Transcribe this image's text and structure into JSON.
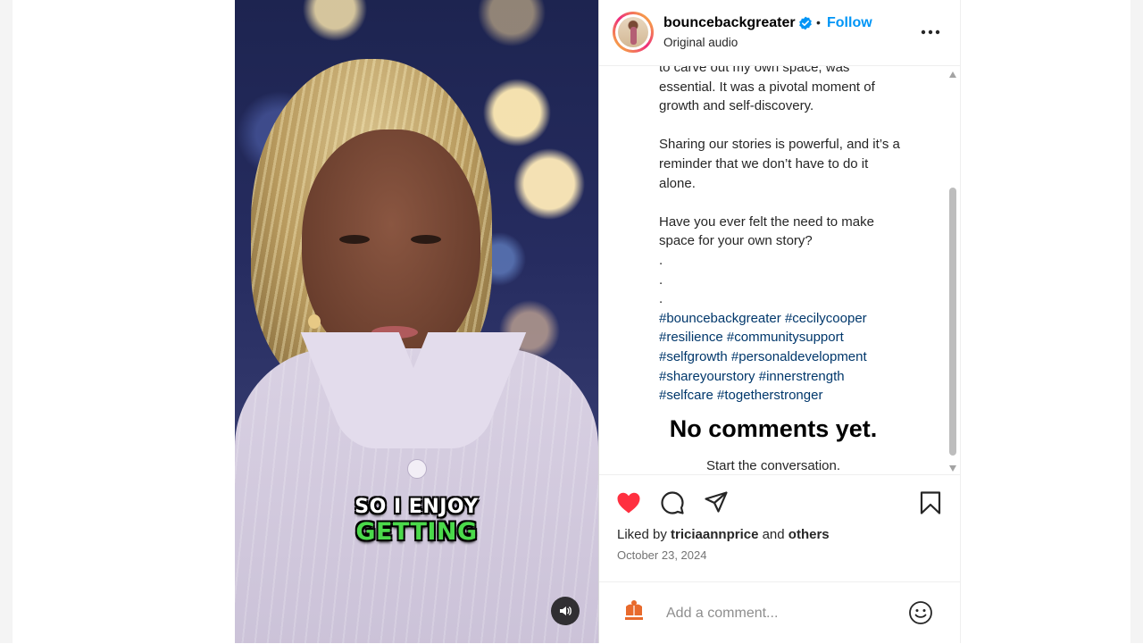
{
  "header": {
    "username": "bounceback­greater",
    "separator": "•",
    "follow_label": "Follow",
    "audio_label": "Original audio"
  },
  "video": {
    "caption_line1": "SO I ENJOY",
    "caption_line2": "GETTING"
  },
  "post": {
    "caption_lines": [
      "to carve out my own space, was",
      "essential. It was a pivotal moment of",
      "growth and self-discovery.",
      "",
      "Sharing our stories is powerful, and it’s a",
      "reminder that we don’t have to do it",
      "alone.",
      "",
      "Have you ever felt the need to make",
      "space for your own story?",
      ".",
      ".",
      "."
    ],
    "hashtag_lines": [
      [
        "#bouncebackgreater",
        "#cecilycooper"
      ],
      [
        "#resilience",
        "#communitysupport"
      ],
      [
        "#selfgrowth",
        "#personaldevelopment"
      ],
      [
        "#shareyourstory",
        "#innerstrength"
      ],
      [
        "#selfcare",
        "#togetherstronger"
      ]
    ],
    "no_comments": "No comments yet.",
    "start_conversation": "Start the conversation."
  },
  "engagement": {
    "liked_prefix": "Liked by ",
    "liked_user": "triciaannprice",
    "liked_middle": " and ",
    "liked_others": "others",
    "date": "October 23, 2024"
  },
  "comment": {
    "placeholder": "Add a comment..."
  },
  "colors": {
    "heart": "#ff3040",
    "follow": "#0095f6",
    "hashtag": "#00376b",
    "verified": "#0095f6"
  },
  "icons": [
    "heart-icon",
    "comment-icon",
    "share-icon",
    "bookmark-icon",
    "more-icon",
    "verified-icon",
    "speaker-icon",
    "emoji-icon"
  ]
}
